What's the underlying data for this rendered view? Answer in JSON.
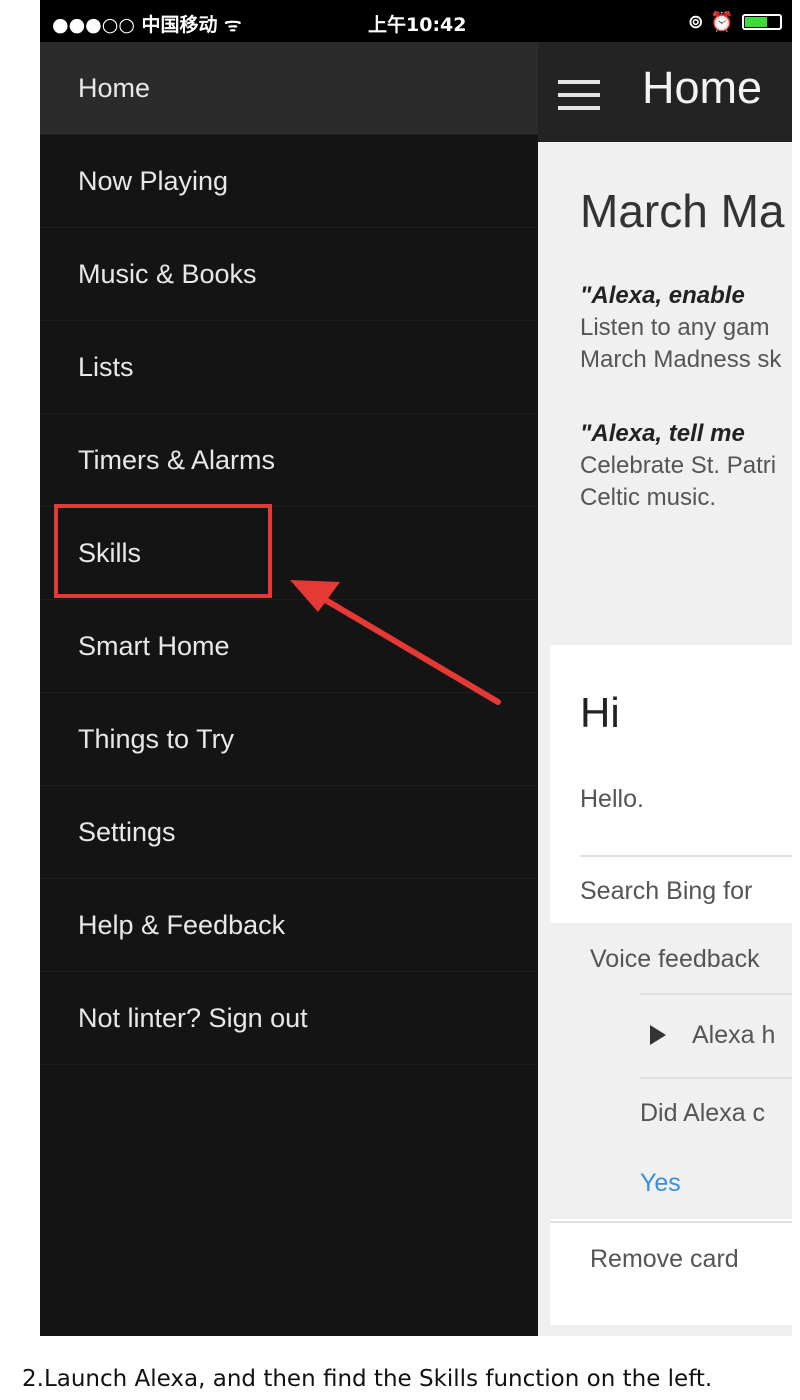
{
  "status_bar": {
    "carrier": "●●●○○ 中国移动 ᯤ",
    "time": "上午10:42",
    "icons": "⊚ ⏰"
  },
  "drawer": {
    "items": [
      {
        "label": "Home"
      },
      {
        "label": "Now Playing"
      },
      {
        "label": "Music & Books"
      },
      {
        "label": "Lists"
      },
      {
        "label": "Timers & Alarms"
      },
      {
        "label": "Skills"
      },
      {
        "label": "Smart Home"
      },
      {
        "label": "Things to Try"
      },
      {
        "label": "Settings"
      },
      {
        "label": "Help & Feedback"
      },
      {
        "label": "Not linter? Sign out"
      }
    ],
    "active_index": 0
  },
  "appbar": {
    "title": "Home"
  },
  "card1": {
    "title": "March Ma",
    "quote1": "\"Alexa, enable",
    "desc1_line1": "Listen to any gam",
    "desc1_line2": "March Madness sk",
    "quote2": "\"Alexa, tell me",
    "desc2_line1": "Celebrate St. Patri",
    "desc2_line2": "Celtic music."
  },
  "card2": {
    "title": "Hi",
    "body": "Hello.",
    "search": "Search Bing for",
    "voice_feedback": "Voice feedback",
    "alexa_heard": "Alexa h",
    "did_alexa": "Did Alexa c",
    "yes": "Yes",
    "remove": "Remove card"
  },
  "caption": "2.Launch Alexa, and then find the Skills function on the left.",
  "colors": {
    "highlight": "#e53935",
    "link": "#3a8fd6"
  }
}
